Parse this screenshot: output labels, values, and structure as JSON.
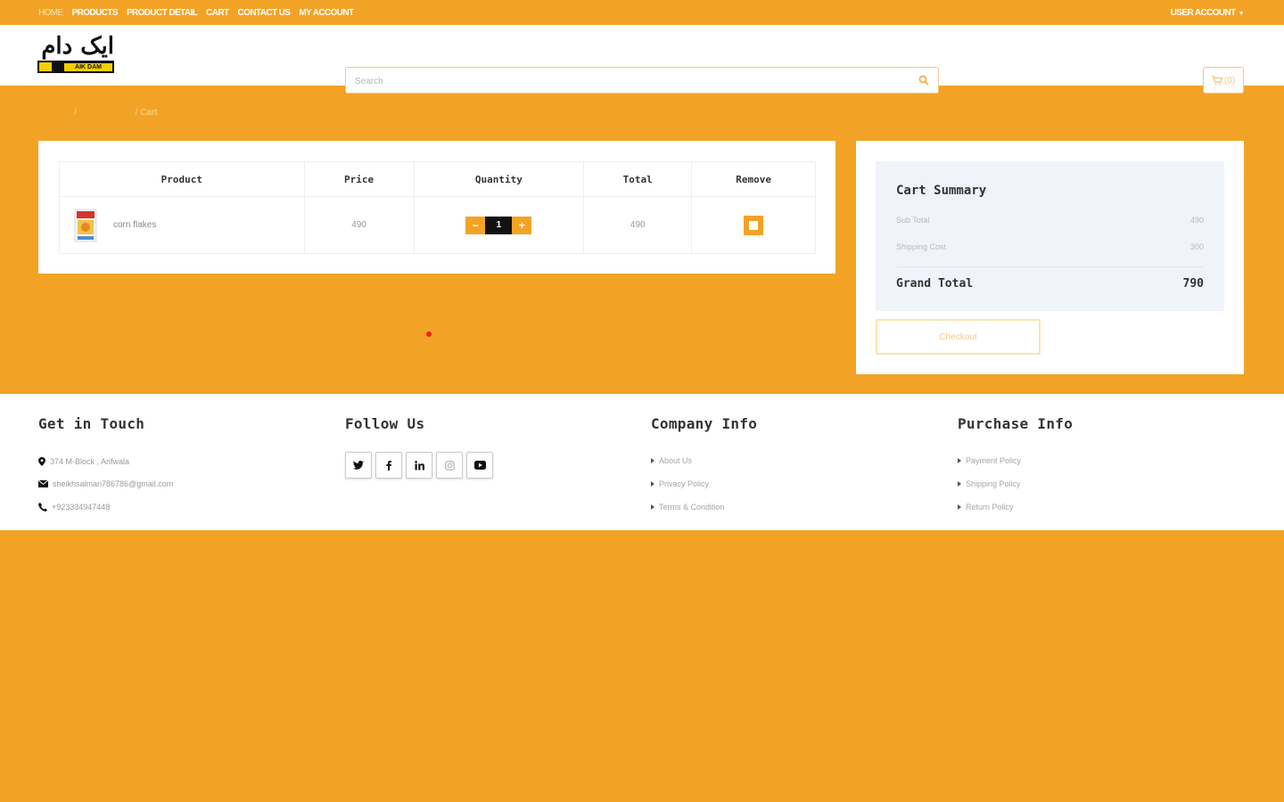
{
  "topnav": {
    "items": [
      "HOME",
      "PRODUCTS",
      "PRODUCT DETAIL",
      "CART",
      "CONTACT US",
      "MY ACCOUNT"
    ],
    "user_account": "USER ACCOUNT"
  },
  "header": {
    "logo_arabic": "ایک دام",
    "logo_strip_text": "AIK DAM",
    "search_placeholder": "Search",
    "cart_count": "(0)"
  },
  "breadcrumb": {
    "separator1": "/",
    "current": "/ Cart"
  },
  "cart_table": {
    "headers": [
      "Product",
      "Price",
      "Quantity",
      "Total",
      "Remove"
    ],
    "rows": [
      {
        "product": "corn flakes",
        "price": "490",
        "quantity": "1",
        "total": "490"
      }
    ],
    "minus": "−",
    "plus": "+"
  },
  "summary": {
    "title": "Cart Summary",
    "subtotal_label": "Sub Total",
    "subtotal_value": "490",
    "shipping_label": "Shipping Cost",
    "shipping_value": "300",
    "grand_label": "Grand Total",
    "grand_value": "790",
    "checkout_label": "Checkout"
  },
  "footer": {
    "get_in_touch": {
      "title": "Get in Touch",
      "address": "374 M-Block , Arifwala",
      "email": "sheikhsalman786786@gmail.com",
      "phone": "+923334947448"
    },
    "follow_us": {
      "title": "Follow Us",
      "icons": [
        "twitter-icon",
        "facebook-icon",
        "linkedin-icon",
        "instagram-icon",
        "youtube-icon"
      ]
    },
    "company_info": {
      "title": "Company Info",
      "links": [
        "About Us",
        "Privacy Policy",
        "Terms & Condition"
      ]
    },
    "purchase_info": {
      "title": "Purchase Info",
      "links": [
        "Payment Policy",
        "Shipping Policy",
        "Return Policy"
      ]
    }
  },
  "colors": {
    "brand": "#f2a325",
    "summary_bg": "#f1f3fb"
  }
}
